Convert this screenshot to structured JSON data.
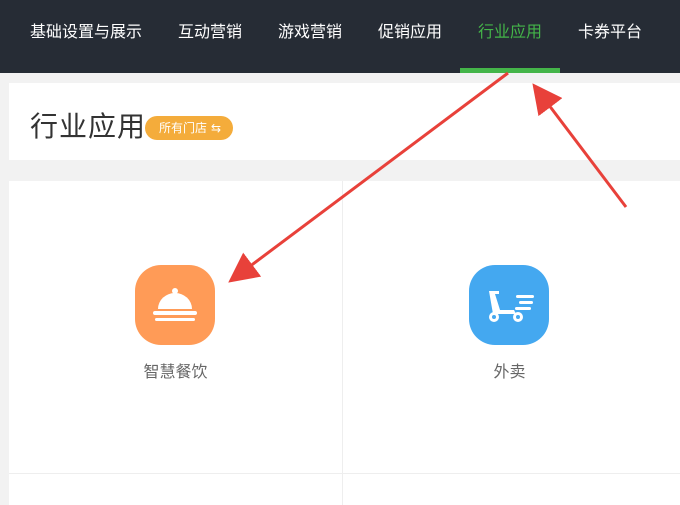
{
  "nav": {
    "items": [
      {
        "label": "基础设置与展示"
      },
      {
        "label": "互动营销"
      },
      {
        "label": "游戏营销"
      },
      {
        "label": "促销应用"
      },
      {
        "label": "行业应用",
        "active": true
      },
      {
        "label": "卡券平台"
      }
    ]
  },
  "header": {
    "title": "行业应用",
    "store_badge": "所有门店",
    "store_badge_icon": "⇆"
  },
  "apps": [
    {
      "label": "智慧餐饮",
      "icon": "dining-cloche-icon",
      "color": "#ff9b57"
    },
    {
      "label": "外卖",
      "icon": "delivery-scooter-icon",
      "color": "#44a8f0"
    }
  ],
  "colors": {
    "nav_bg": "#262c35",
    "accent": "#44b549",
    "badge": "#f4ac3b",
    "annotation_arrow": "#e8413a"
  }
}
